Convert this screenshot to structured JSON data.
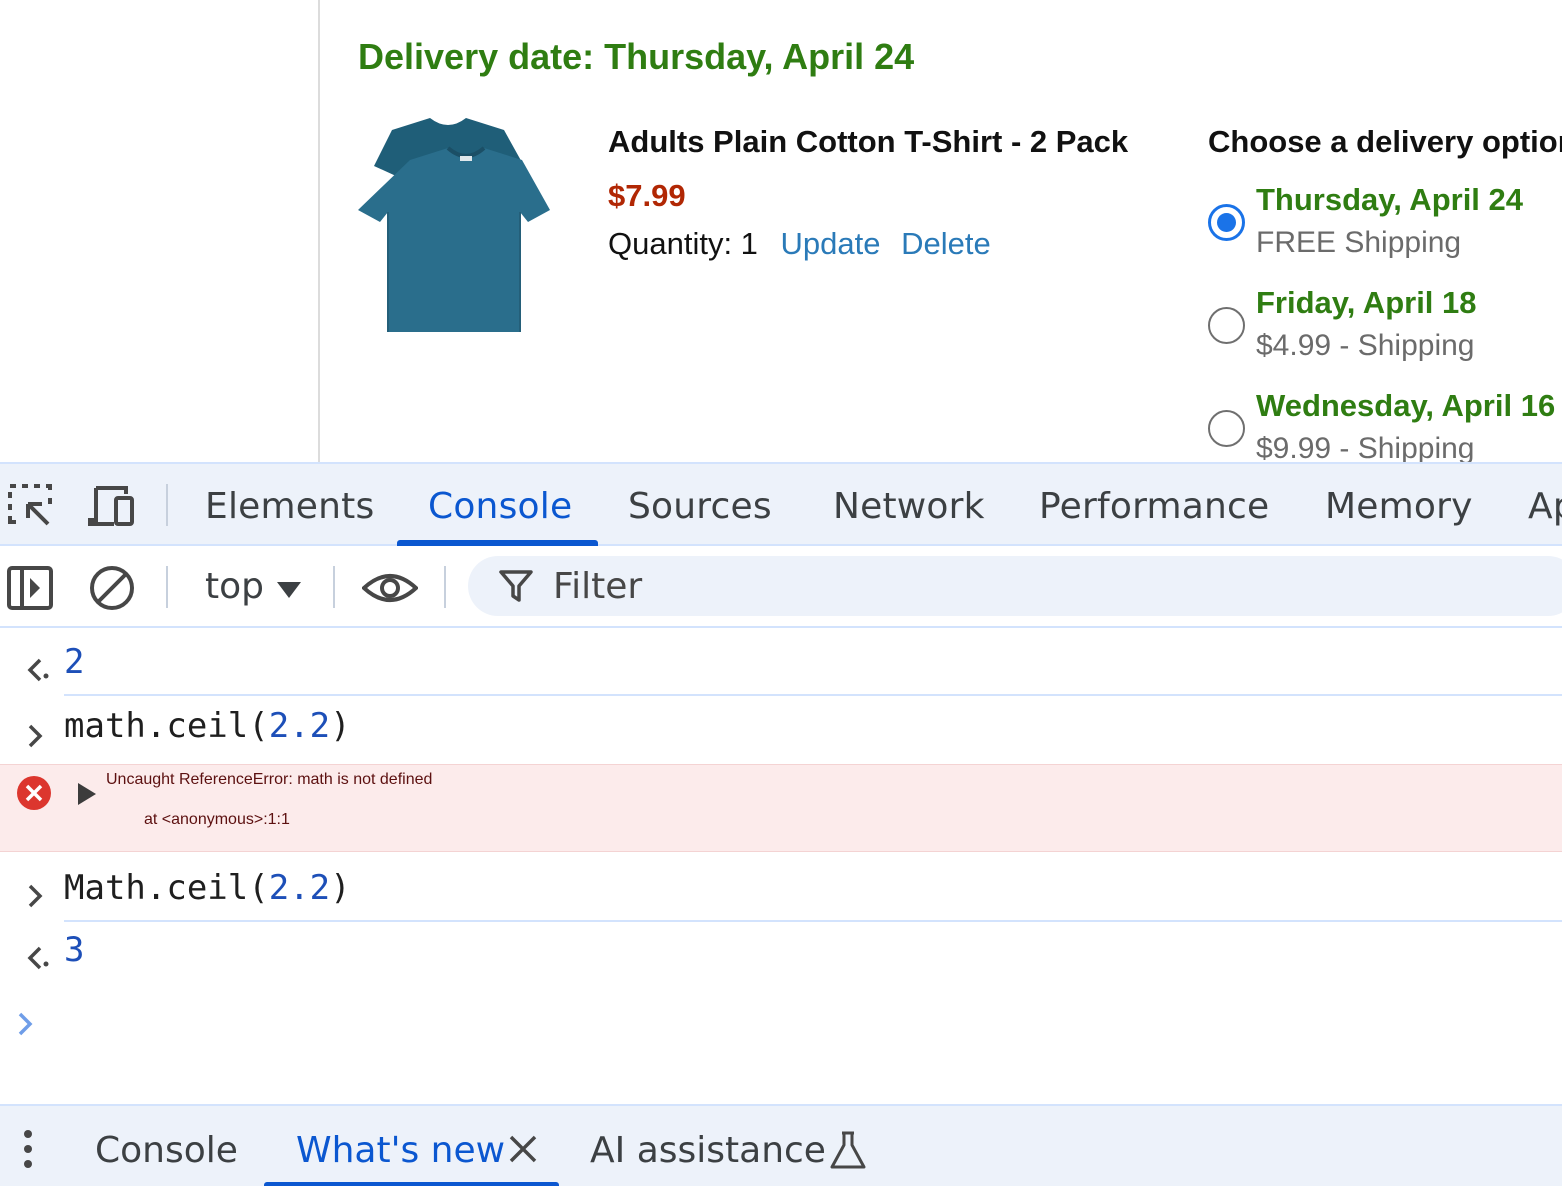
{
  "page": {
    "delivery_date": "Delivery date: Thursday, April 24",
    "product": {
      "name": "Adults Plain Cotton T-Shirt - 2 Pack",
      "price": "$7.99",
      "quantity_label": "Quantity: 1",
      "update_link": "Update",
      "delete_link": "Delete"
    },
    "delivery_options_title": "Choose a delivery option",
    "delivery_options": [
      {
        "date": "Thursday, April 24",
        "price": "FREE Shipping",
        "selected": true
      },
      {
        "date": "Friday, April 18",
        "price": "$4.99 - Shipping",
        "selected": false
      },
      {
        "date": "Wednesday, April 16",
        "price": "$9.99 - Shipping",
        "selected": false
      }
    ],
    "colors": {
      "green": "#2f7d12",
      "price_red": "#b12704",
      "link_blue": "#2a7ab8"
    }
  },
  "devtools": {
    "tabs": [
      "Elements",
      "Console",
      "Sources",
      "Network",
      "Performance",
      "Memory",
      "Ap"
    ],
    "active_tab": "Console",
    "toolbar": {
      "context": "top",
      "filter_placeholder": "Filter"
    },
    "console": {
      "lines": [
        {
          "kind": "result",
          "text": "2"
        },
        {
          "kind": "input",
          "text": "math.ceil(2.2)"
        },
        {
          "kind": "error",
          "line1": "Uncaught ReferenceError: math is not defined",
          "line2": "at <anonymous>:1:1"
        },
        {
          "kind": "input",
          "text": "Math.ceil(2.2)"
        },
        {
          "kind": "result",
          "text": "3"
        }
      ],
      "input_code": {
        "line2_prefix": "math.ceil(",
        "line2_num": "2.2",
        "line2_suffix": ")",
        "line4_prefix": "Math.ceil(",
        "line4_num": "2.2",
        "line4_suffix": ")"
      }
    },
    "drawer": {
      "tabs": [
        "Console",
        "What's new",
        "AI assistance"
      ],
      "active_tab": "What's new"
    },
    "colors": {
      "accent": "#0b57d0",
      "tab_bg": "#edf2fa",
      "error_bg": "#fcebeb"
    }
  }
}
